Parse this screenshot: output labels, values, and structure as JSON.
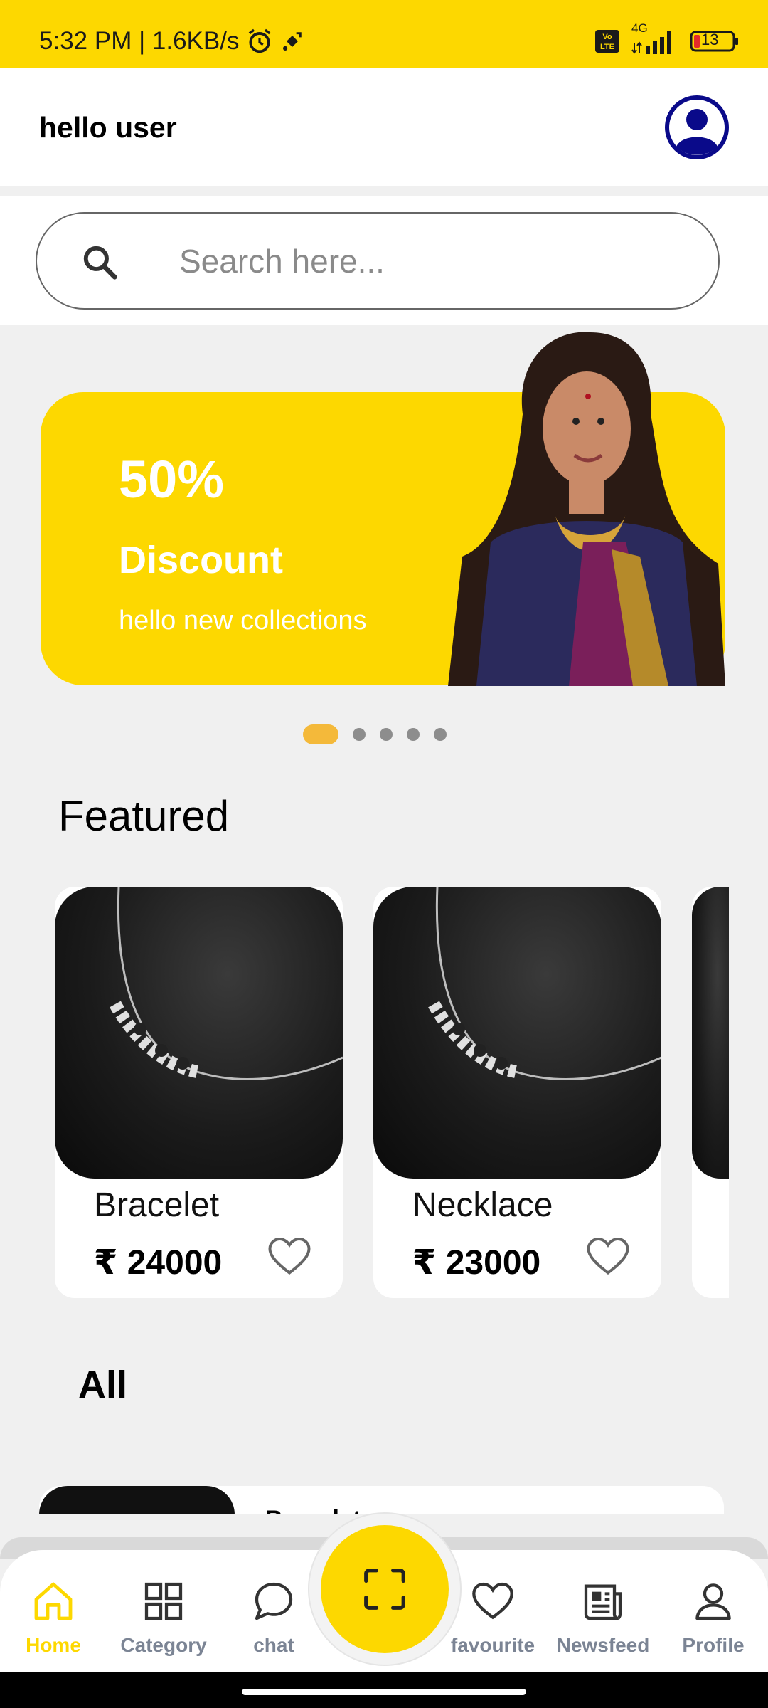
{
  "status": {
    "time_speed": "5:32 PM | 1.6KB/s",
    "network": "4G",
    "battery": "13"
  },
  "header": {
    "greeting": "hello user"
  },
  "search": {
    "placeholder": "Search here..."
  },
  "banner": {
    "percent": "50%",
    "title": "Discount",
    "subtitle": "hello new collections"
  },
  "carousel": {
    "total": 5,
    "active_index": 0
  },
  "sections": {
    "featured": "Featured",
    "all": "All"
  },
  "featured": [
    {
      "name": "Bracelet",
      "price": "₹ 24000"
    },
    {
      "name": "Necklace",
      "price": "₹ 23000"
    }
  ],
  "all_list": [
    {
      "name": "Bracelet"
    }
  ],
  "nav": {
    "home": "Home",
    "category": "Category",
    "chat": "chat",
    "favourite": "favourite",
    "newsfeed": "Newsfeed",
    "profile": "Profile"
  },
  "colors": {
    "accent": "#fdd800",
    "avatar": "#0a0a8a",
    "nav_inactive": "#7b8494"
  }
}
